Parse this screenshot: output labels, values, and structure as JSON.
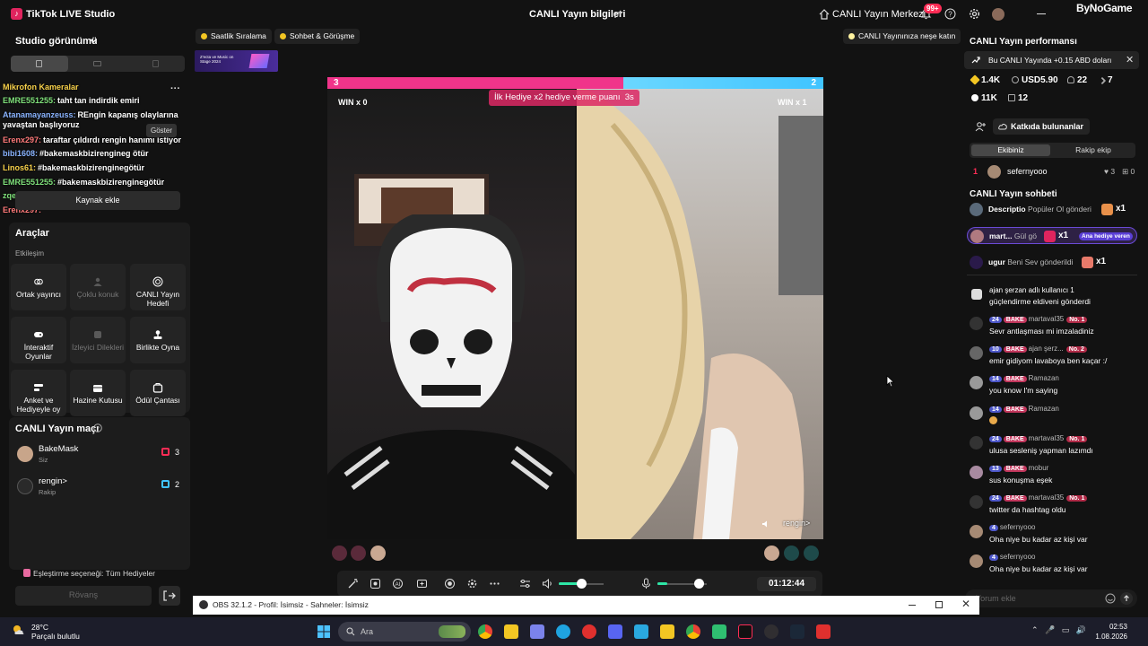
{
  "titlebar": {
    "app_name": "TikTok LIVE Studio",
    "title": "CANLI Yayın bilgileri",
    "center_link": "CANLI Yayın Merkezi",
    "notif_badge": "99+",
    "watermark": "ByNoGame"
  },
  "left": {
    "studio_view": "Studio görünümü",
    "overlay_chat": [
      {
        "user": "Mikrofon Kameralar",
        "text": ""
      },
      {
        "user": "EMRE551255:",
        "text": "taht tan indirdik emiri"
      },
      {
        "user": "Atanamayanzeuss:",
        "text": "REngin kapanış olaylarına"
      },
      {
        "user": "",
        "text": "yavaştan başlıyoruz"
      },
      {
        "user": "Erenx297:",
        "text": "taraftar çıldırdı rengin hanımı istiyor"
      },
      {
        "user": "bibi1608:",
        "text": "#bakemaskbizirengineg ötür"
      },
      {
        "user": "Linos61:",
        "text": "#bakemaskbizirenginegötür"
      },
      {
        "user": "EMRE551255:",
        "text": "#bakemaskbizirenginegötür"
      },
      {
        "user": "zqewa:",
        "text": ""
      },
      {
        "user": "Erenx297:",
        "text": ""
      }
    ],
    "goster": "Göster",
    "add_source": "Kaynak ekle",
    "tools_title": "Araçlar",
    "tools_subtitle": "Etkileşim",
    "tools": [
      {
        "label": "Ortak yayıncı",
        "icon": "link-icon",
        "enabled": true
      },
      {
        "label": "Çoklu konuk",
        "icon": "people-icon",
        "enabled": false
      },
      {
        "label": "CANLI Yayın Hedefi",
        "icon": "target-icon",
        "enabled": true
      },
      {
        "label": "İnteraktif Oyunlar",
        "icon": "gamepad-icon",
        "enabled": true
      },
      {
        "label": "İzleyici Dilekleri",
        "icon": "wish-icon",
        "enabled": false
      },
      {
        "label": "Birlikte Oyna",
        "icon": "joystick-icon",
        "enabled": true
      },
      {
        "label": "Anket ve Hediyeyle oy",
        "icon": "poll-icon",
        "enabled": true
      },
      {
        "label": "Hazine Kutusu",
        "icon": "chest-icon",
        "enabled": true
      },
      {
        "label": "Ödül Çantası",
        "icon": "bag-icon",
        "enabled": true
      }
    ],
    "match_title": "CANLI Yayın maçı",
    "match_rows": [
      {
        "name": "BakeMask",
        "sub": "Siz",
        "score": "3",
        "color": "#fe2c55"
      },
      {
        "name": "rengin>",
        "sub": "Rakip",
        "score": "2",
        "color": "#40c4ff"
      }
    ],
    "pair_option": "Eşleştirme seçeneği: Tüm Hediyeler",
    "rematch": "Rövanş"
  },
  "center": {
    "chip_hourly": "Saatlik Sıralama",
    "chip_chat": "Sohbet & Görüşme",
    "chip_tip": "CANLI Yayınınıza neşe katın",
    "banner_text": "Z'ecta ve Music on Stage 2024",
    "score_left": "3",
    "score_right": "2",
    "gift_tip": "İlk Hediye x2 hediye verme puanı",
    "gift_tip_time": "3s",
    "win_left": "WIN x 0",
    "win_right": "WIN x 1",
    "opponent_tag": "rengin>",
    "timer": "01:12:44",
    "volume_level": 0.5,
    "mic_level": 0.2
  },
  "right": {
    "perf_title": "CANLI Yayın performansı",
    "promo": "Bu CANLI Yayında +0.15 ABD doları",
    "stats": [
      {
        "icon": "diamond-icon",
        "value": "1.4K",
        "color": "#f3c623"
      },
      {
        "icon": "dollar-icon",
        "value": "USD5.90",
        "color": "#aaa"
      },
      {
        "icon": "users-icon",
        "value": "22",
        "color": "#aaa"
      },
      {
        "icon": "arrow-icon",
        "value": "7",
        "color": "#aaa"
      },
      {
        "icon": "heart-icon",
        "value": "11K",
        "color": "#fff"
      },
      {
        "icon": "gift-icon",
        "value": "12",
        "color": "#aaa"
      }
    ],
    "contributors": "Katkıda bulunanlar",
    "tab_team": "Ekibiniz",
    "tab_rival": "Rakip ekip",
    "rank": {
      "n": "1",
      "name": "sefernyooo",
      "hearts": "3",
      "gifts": "0"
    },
    "chat_title": "CANLI Yayın sohbeti",
    "gifts": [
      {
        "user": "Descriptio",
        "text": "Popüler Ol gönderi",
        "count": "x1"
      },
      {
        "user": "mart...",
        "text": "Gül gö",
        "count": "x1",
        "badge": "Ana hediye veren"
      },
      {
        "user": "ugur",
        "text": "Beni Sev gönderildi",
        "count": "x1"
      }
    ],
    "messages": [
      {
        "head": "ajan şerzan adlı kullanıcı 1",
        "body": "güçlendirme eldiveni gönderdi",
        "lvl": "",
        "fan": "",
        "no": ""
      },
      {
        "head": "martaval35",
        "body": "Sevr antlaşması mi imzaladiniz",
        "lvl": "24",
        "fan": "BAKE",
        "no": "No. 1"
      },
      {
        "head": "ajan şerz...",
        "body": "emir gidiyom lavaboya ben kaçar :/",
        "lvl": "10",
        "fan": "BAKE",
        "no": "No. 2"
      },
      {
        "head": "Ramazan",
        "body": "you know I'm saying",
        "lvl": "14",
        "fan": "BAKE",
        "no": ""
      },
      {
        "head": "Ramazan",
        "body": "",
        "lvl": "14",
        "fan": "BAKE",
        "no": ""
      },
      {
        "head": "martaval35",
        "body": "ulusa sesleniş yapman lazımdı",
        "lvl": "24",
        "fan": "BAKE",
        "no": "No. 1"
      },
      {
        "head": "mobur",
        "body": "sus konuşma eşek",
        "lvl": "13",
        "fan": "BAKE",
        "no": ""
      },
      {
        "head": "martaval35",
        "body": "twitter da hashtag oldu",
        "lvl": "24",
        "fan": "BAKE",
        "no": "No. 1"
      },
      {
        "head": "sefernyooo",
        "body": "Oha niye bu kadar az kişi var",
        "lvl": "4",
        "fan": "",
        "no": ""
      },
      {
        "head": "sefernyooo",
        "body": "Oha niye bu kadar az kişi var",
        "lvl": "4",
        "fan": "",
        "no": ""
      }
    ],
    "comment_placeholder": "Yorum ekle"
  },
  "obs": {
    "title": "OBS 32.1.2 - Profil: İsimsiz - Sahneler: İsimsiz"
  },
  "taskbar": {
    "temp": "28°C",
    "weather": "Parçalı bulutlu",
    "search": "Ara",
    "time": "02:53",
    "date": "1.08.2026"
  }
}
